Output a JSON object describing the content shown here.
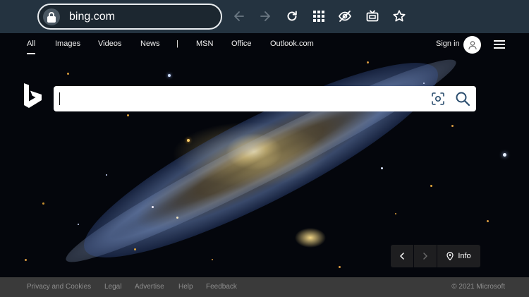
{
  "browser": {
    "url": "bing.com",
    "icons": [
      "lock-icon",
      "back-arrow-icon",
      "forward-arrow-icon",
      "reload-icon",
      "apps-grid-icon",
      "eye-slash-icon",
      "tv-icon",
      "star-icon"
    ]
  },
  "nav": {
    "items": [
      "All",
      "Images",
      "Videos",
      "News",
      "|",
      "MSN",
      "Office",
      "Outlook.com"
    ],
    "active": "All",
    "sign_in": "Sign in"
  },
  "search": {
    "value": "",
    "placeholder": ""
  },
  "image_controls": {
    "info_label": "Info"
  },
  "footer": {
    "links": [
      "Privacy and Cookies",
      "Legal",
      "Advertise",
      "Help",
      "Feedback"
    ],
    "copyright": "© 2021 Microsoft"
  },
  "colors": {
    "chrome_bg": "#243340",
    "footer_bg": "#3a3a3a",
    "footer_text": "#8e8e8e",
    "search_icon": "#2a4d6e"
  }
}
